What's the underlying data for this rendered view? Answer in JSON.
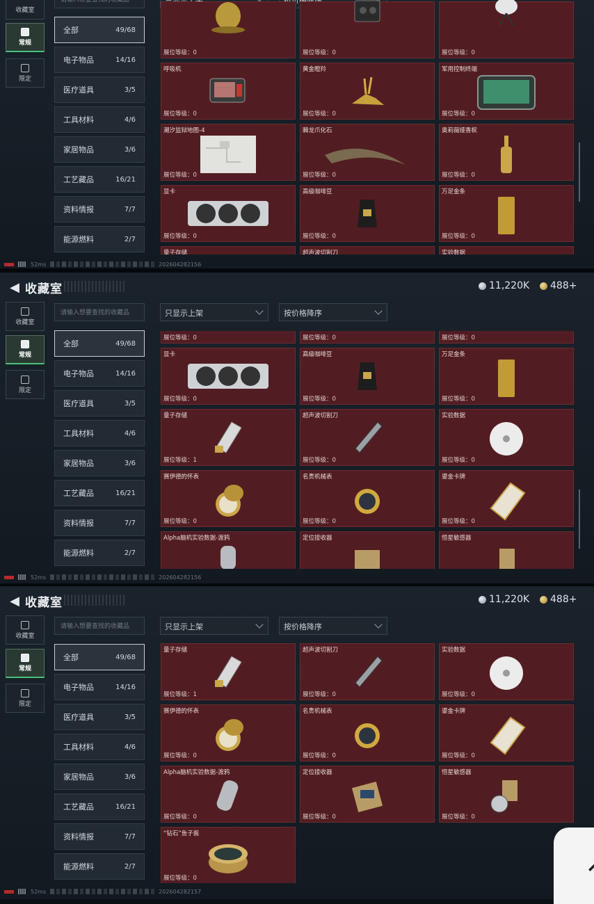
{
  "app": {
    "title": "收藏室",
    "currency_silver": "11,220K",
    "currency_gold": "488+"
  },
  "nav": [
    {
      "label": "收藏室"
    },
    {
      "label": "常规"
    },
    {
      "label": "限定"
    }
  ],
  "search": {
    "placeholder": "请输入想要查找的收藏品"
  },
  "filters": {
    "shelf": "只显示上架",
    "sort": "按价格降序"
  },
  "categories": [
    {
      "label": "全部",
      "count": "49/68"
    },
    {
      "label": "电子物品",
      "count": "14/16"
    },
    {
      "label": "医疗道具",
      "count": "3/5"
    },
    {
      "label": "工具材料",
      "count": "4/6"
    },
    {
      "label": "家居物品",
      "count": "3/6"
    },
    {
      "label": "工艺藏品",
      "count": "16/21"
    },
    {
      "label": "资料情报",
      "count": "7/7"
    },
    {
      "label": "能源燃料",
      "count": "2/7"
    }
  ],
  "level_text": "展位等级：0",
  "level_text_1": "展位等级：1",
  "items": [
    {
      "name": "呼吸机"
    },
    {
      "name": "黄金瞪羚"
    },
    {
      "name": "军用控制终端"
    },
    {
      "name": "潮汐监狱地图-4"
    },
    {
      "name": "棘龙爪化石"
    },
    {
      "name": "奥莉薇娅香槟"
    },
    {
      "name": "显卡"
    },
    {
      "name": "高级咖啡豆"
    },
    {
      "name": "万足金条"
    },
    {
      "name": "量子存储"
    },
    {
      "name": "超声波切割刀"
    },
    {
      "name": "实验数据"
    },
    {
      "name": "赛伊德的怀表"
    },
    {
      "name": "名贵机械表"
    },
    {
      "name": "鎏金卡牌"
    },
    {
      "name": "Alpha脑机实验数据-渡鸦"
    },
    {
      "name": "定位接收器"
    },
    {
      "name": "恒星敏感器"
    },
    {
      "name": "“钻石”鱼子酱"
    }
  ],
  "status": {
    "ping": "52ms",
    "id_1": "202604282156",
    "id_2": "202604282156",
    "id_3": "202604282157"
  },
  "colors": {
    "card_bg": "#521d22",
    "accent_green": "#48c27a",
    "gold": "#c9a74a"
  }
}
